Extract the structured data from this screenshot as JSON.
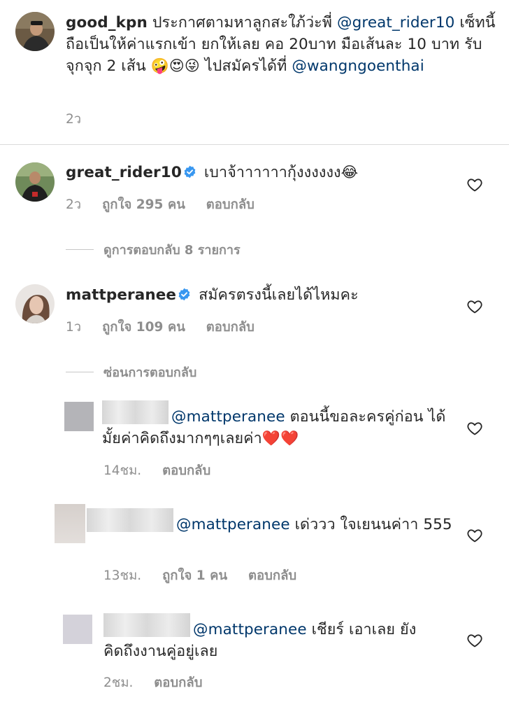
{
  "caption": {
    "username": "good_kpn",
    "text_1": "ประกาศตามหาลูกสะใภ้ว่ะพี่",
    "mention_1": "@great_rider10",
    "text_2": "เซ็ทนี้ ถือเป็นให้ค่าแรกเข้า ยกให้เลย คอ 20บาท มือเส้นละ 10 บาท รับจุกจุก 2 เส้น",
    "emojis": "🤪😍😜",
    "text_3": "ไปสมัครได้ที่",
    "mention_2": "@wangngoenthai",
    "time": "2ว"
  },
  "comments": [
    {
      "username": "great_rider10",
      "verified": true,
      "text": "เบาจ้าาาาาากุ้งงงงงง",
      "emoji": "😂",
      "time": "2ว",
      "likes": "ถูกใจ 295 คน",
      "reply": "ตอบกลับ",
      "view_replies": "ดูการตอบกลับ 8 รายการ"
    },
    {
      "username": "mattperanee",
      "verified": true,
      "text": "สมัครตรงนี้เลยได้ไหมคะ",
      "time": "1ว",
      "likes": "ถูกใจ 109 คน",
      "reply": "ตอบกลับ",
      "hide_replies": "ซ่อนการตอบกลับ"
    }
  ],
  "replies": [
    {
      "mention": "@mattperanee",
      "text": "ตอนนี้ขอละครคู่ก่อน ได้มั้ยค่าคิดถึงมากๆๆเลยค่า",
      "emoji": "❤️❤️",
      "time": "14ชม.",
      "reply": "ตอบกลับ"
    },
    {
      "mention": "@mattperanee",
      "text": "เด่ววว ใจเยนนค่าา 555",
      "time": "13ชม.",
      "likes": "ถูกใจ 1 คน",
      "reply": "ตอบกลับ"
    },
    {
      "mention": "@mattperanee",
      "text": "เชียร์ เอาเลย ยัง คิดถึงงานคู่อยู่เลย",
      "time": "2ชม.",
      "reply": "ตอบกลับ"
    }
  ],
  "colors": {
    "text": "#262626",
    "meta": "#8e8e8e",
    "mention": "#00376b",
    "verified": "#3897f0",
    "divider": "#dbdbdb"
  }
}
